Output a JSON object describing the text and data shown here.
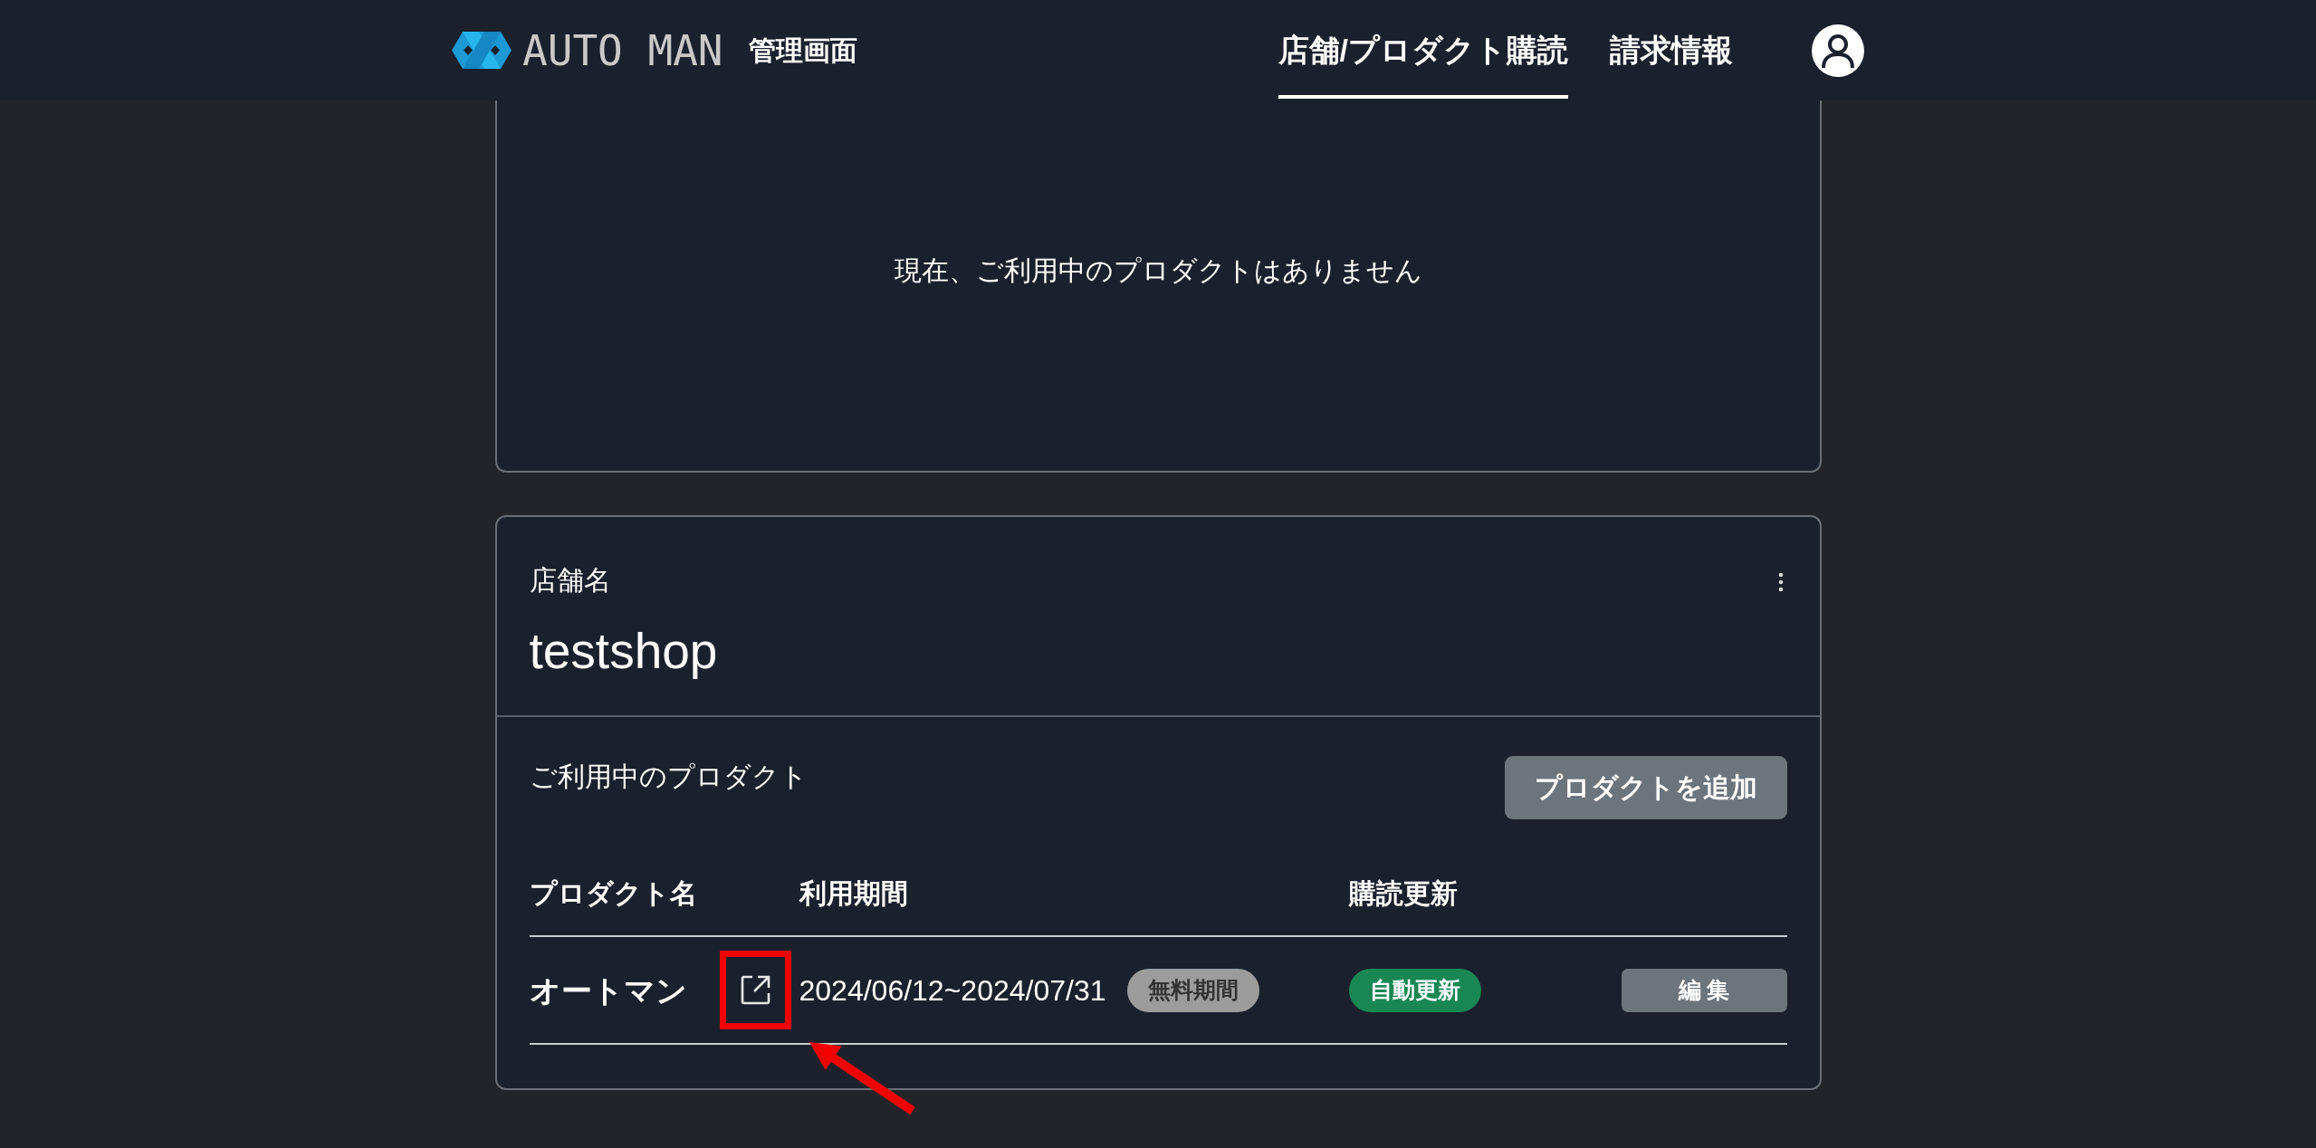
{
  "header": {
    "logo_text": "AUTO MAN",
    "subtitle": "管理画面",
    "nav": [
      {
        "label": "店舗/プロダクト購読",
        "selected": true
      },
      {
        "label": "請求情報",
        "selected": false
      }
    ]
  },
  "empty_card": {
    "message": "現在、ご利用中のプロダクトはありません"
  },
  "shop_card": {
    "label": "店舗名",
    "name": "testshop",
    "section_title": "ご利用中のプロダクト",
    "add_button": "プロダクトを追加",
    "table": {
      "columns": [
        "プロダクト名",
        "利用期間",
        "購読更新"
      ],
      "rows": [
        {
          "product": "オートマン",
          "period": "2024/06/12~2024/07/31",
          "period_badge": "無料期間",
          "renewal_badge": "自動更新",
          "edit_button": "編 集"
        }
      ]
    }
  },
  "annotations": {
    "highlight_frame": true,
    "arrow": true
  }
}
